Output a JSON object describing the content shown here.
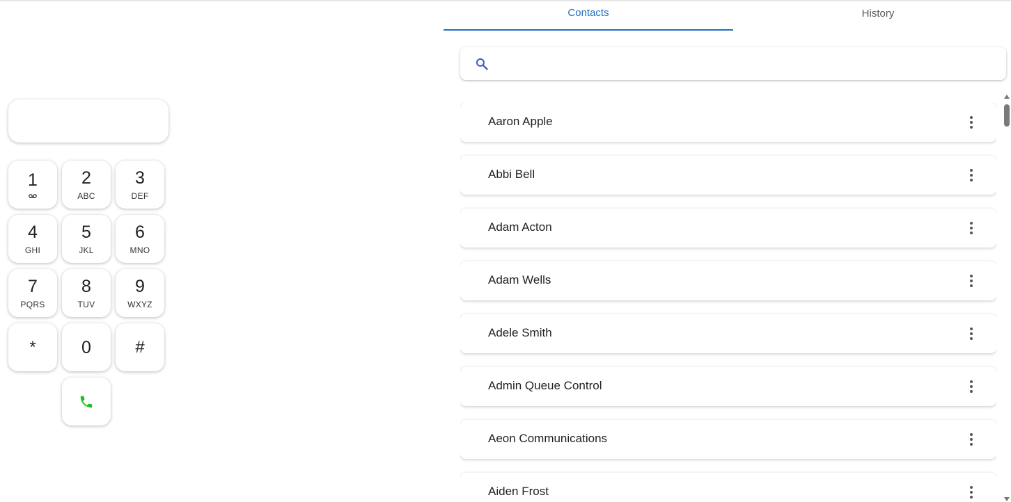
{
  "dialer": {
    "display_value": "",
    "keys": [
      {
        "digit": "1",
        "letters": "",
        "icon": "voicemail-icon"
      },
      {
        "digit": "2",
        "letters": "ABC"
      },
      {
        "digit": "3",
        "letters": "DEF"
      },
      {
        "digit": "4",
        "letters": "GHI"
      },
      {
        "digit": "5",
        "letters": "JKL"
      },
      {
        "digit": "6",
        "letters": "MNO"
      },
      {
        "digit": "7",
        "letters": "PQRS"
      },
      {
        "digit": "8",
        "letters": "TUV"
      },
      {
        "digit": "9",
        "letters": "WXYZ"
      },
      {
        "digit": "*",
        "letters": ""
      },
      {
        "digit": "0",
        "letters": ""
      },
      {
        "digit": "#",
        "letters": ""
      }
    ],
    "call_icon": "phone-icon",
    "call_color": "#1fbf1f"
  },
  "tabs": [
    {
      "label": "Contacts",
      "active": true
    },
    {
      "label": "History",
      "active": false
    }
  ],
  "search": {
    "placeholder": "",
    "value": "",
    "icon": "search-icon",
    "icon_color": "#3b5bbf"
  },
  "contacts": [
    {
      "name": "Aaron Apple"
    },
    {
      "name": "Abbi Bell"
    },
    {
      "name": "Adam Acton"
    },
    {
      "name": "Adam Wells"
    },
    {
      "name": "Adele Smith"
    },
    {
      "name": "Admin Queue Control"
    },
    {
      "name": "Aeon Communications"
    },
    {
      "name": "Aiden Frost"
    }
  ],
  "colors": {
    "accent": "#1e6fc4",
    "text": "#222222"
  }
}
